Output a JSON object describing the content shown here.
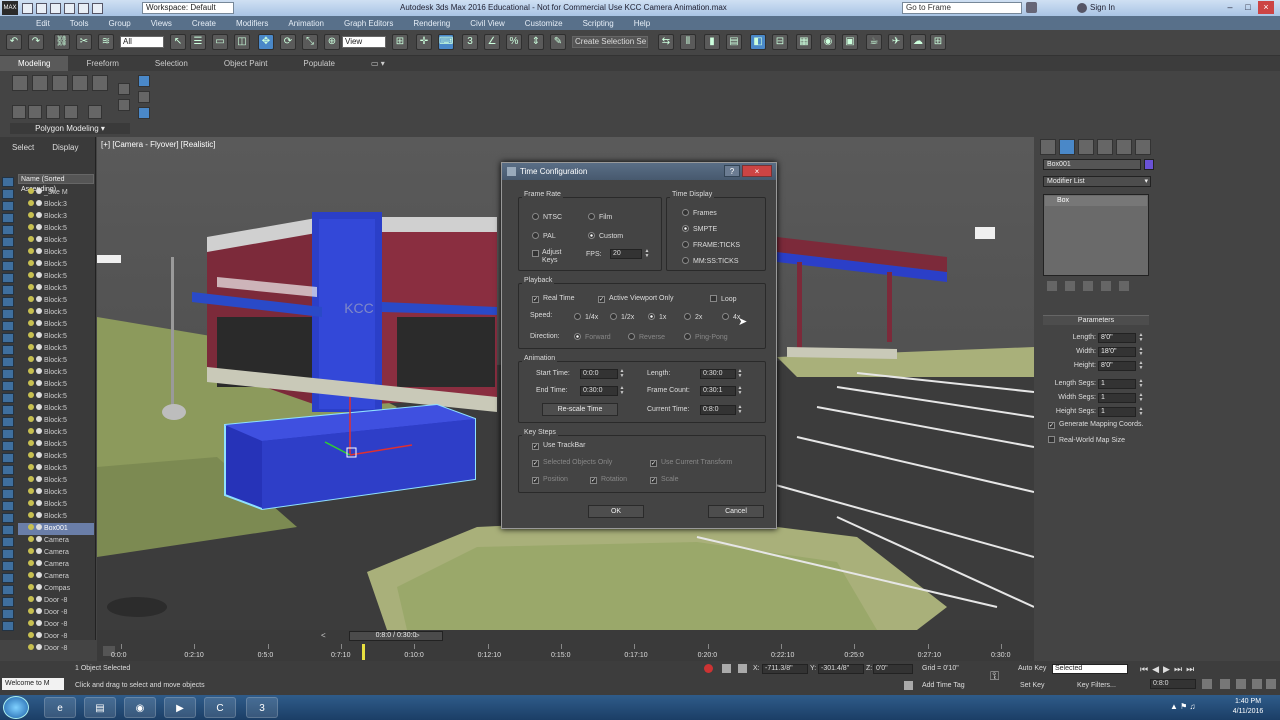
{
  "titlebar": {
    "workspace": "Workspace: Default",
    "title": "Autodesk 3ds Max 2016 Educational - Not for Commercial Use    KCC Camera Animation.max",
    "goto_placeholder": "Go to Frame",
    "signin": "Sign In"
  },
  "menubar": [
    "Edit",
    "Tools",
    "Group",
    "Views",
    "Create",
    "Modifiers",
    "Animation",
    "Graph Editors",
    "Rendering",
    "Civil View",
    "Customize",
    "Scripting",
    "Help"
  ],
  "toolbar": {
    "filter_value": "All",
    "view_value": "View",
    "selection_set_placeholder": "Create Selection Se"
  },
  "ribbon": {
    "tabs": [
      "Modeling",
      "Freeform",
      "Selection",
      "Object Paint",
      "Populate"
    ],
    "active_tab": "Modeling",
    "panel_label": "Polygon Modeling"
  },
  "scene_explorer": {
    "tabs": [
      "Select",
      "Display"
    ],
    "column_header": "Name (Sorted Ascending)",
    "rows": [
      "_Site M",
      "Block:3",
      "Block:3",
      "Block:5",
      "Block:5",
      "Block:5",
      "Block:5",
      "Block:5",
      "Block:5",
      "Block:5",
      "Block:5",
      "Block:5",
      "Block:5",
      "Block:5",
      "Block:5",
      "Block:5",
      "Block:5",
      "Block:5",
      "Block:5",
      "Block:5",
      "Block:5",
      "Block:5",
      "Block:5",
      "Block:5",
      "Block:5",
      "Block:5",
      "Block:5",
      "Block:5",
      "Box001",
      "Camera",
      "Camera",
      "Camera",
      "Camera",
      "Compas",
      "Door -8",
      "Door -8",
      "Door -8",
      "Door -8",
      "Door -8"
    ],
    "selected_index": 28
  },
  "viewport": {
    "label": "[+] [Camera - Flyover] [Realistic]",
    "sign_text": "KCC"
  },
  "command_panel": {
    "object_name": "Box001",
    "object_color": "#6a52d6",
    "modifier_list": "Modifier List",
    "stack_item": "Box",
    "parameters_title": "Parameters",
    "params": [
      {
        "label": "Length:",
        "value": "8'0\""
      },
      {
        "label": "Width:",
        "value": "18'0\""
      },
      {
        "label": "Height:",
        "value": "8'0\""
      },
      {
        "label": "Length Segs:",
        "value": "1"
      },
      {
        "label": "Width Segs:",
        "value": "1"
      },
      {
        "label": "Height Segs:",
        "value": "1"
      }
    ],
    "generate_mapping": "Generate Mapping Coords.",
    "real_world": "Real-World Map Size"
  },
  "dialog": {
    "title": "Time Configuration",
    "frame_rate": {
      "label": "Frame Rate",
      "options": [
        "NTSC",
        "Film",
        "PAL",
        "Custom"
      ],
      "selected": "Custom",
      "adjust_keys": "Adjust Keys",
      "fps_label": "FPS:",
      "fps_value": "20"
    },
    "time_display": {
      "label": "Time Display",
      "options": [
        "Frames",
        "SMPTE",
        "FRAME:TICKS",
        "MM:SS:TICKS"
      ],
      "selected": "SMPTE"
    },
    "playback": {
      "label": "Playback",
      "real_time": "Real Time",
      "active_viewport": "Active Viewport Only",
      "loop": "Loop",
      "speed_label": "Speed:",
      "speeds": [
        "1/4x",
        "1/2x",
        "1x",
        "2x",
        "4x"
      ],
      "speed_selected": "1x",
      "direction_label": "Direction:",
      "directions": [
        "Forward",
        "Reverse",
        "Ping-Pong"
      ]
    },
    "animation": {
      "label": "Animation",
      "start_label": "Start Time:",
      "start_value": "0:0:0",
      "end_label": "End Time:",
      "end_value": "0:30:0",
      "length_label": "Length:",
      "length_value": "0:30:0",
      "count_label": "Frame Count:",
      "count_value": "0:30:1",
      "rescale": "Re-scale Time",
      "current_label": "Current Time:",
      "current_value": "0:8:0"
    },
    "key_steps": {
      "label": "Key Steps",
      "use_trackbar": "Use TrackBar",
      "selected_only": "Selected Objects Only",
      "use_current": "Use Current Transform",
      "position": "Position",
      "rotation": "Rotation",
      "scale": "Scale"
    },
    "ok": "OK",
    "cancel": "Cancel"
  },
  "timeline": {
    "slider": "0:8:0 / 0:30:0",
    "ticks": [
      "0:0:0",
      "0:2:10",
      "0:5:0",
      "0:7:10",
      "0:10:0",
      "0:12:10",
      "0:15:0",
      "0:17:10",
      "0:20:0",
      "0:22:10",
      "0:25:0",
      "0:27:10",
      "0:30:0"
    ]
  },
  "status": {
    "selected": "1 Object Selected",
    "hint": "Click and drag to select and move objects",
    "maxscript": "Welcome to M",
    "x_label": "X:",
    "x_value": "-711.3/8\"",
    "y_label": "Y:",
    "y_value": "-301.4/8\"",
    "z_label": "Z:",
    "z_value": "0'0\"",
    "grid": "Grid = 0'10\"",
    "add_time_tag": "Add Time Tag",
    "auto_key": "Auto Key",
    "set_key": "Set Key",
    "selected_dropdown": "Selected",
    "key_filters": "Key Filters...",
    "frame_field": "0:8:0"
  },
  "taskbar": {
    "time": "1:40 PM",
    "date": "4/11/2016"
  }
}
